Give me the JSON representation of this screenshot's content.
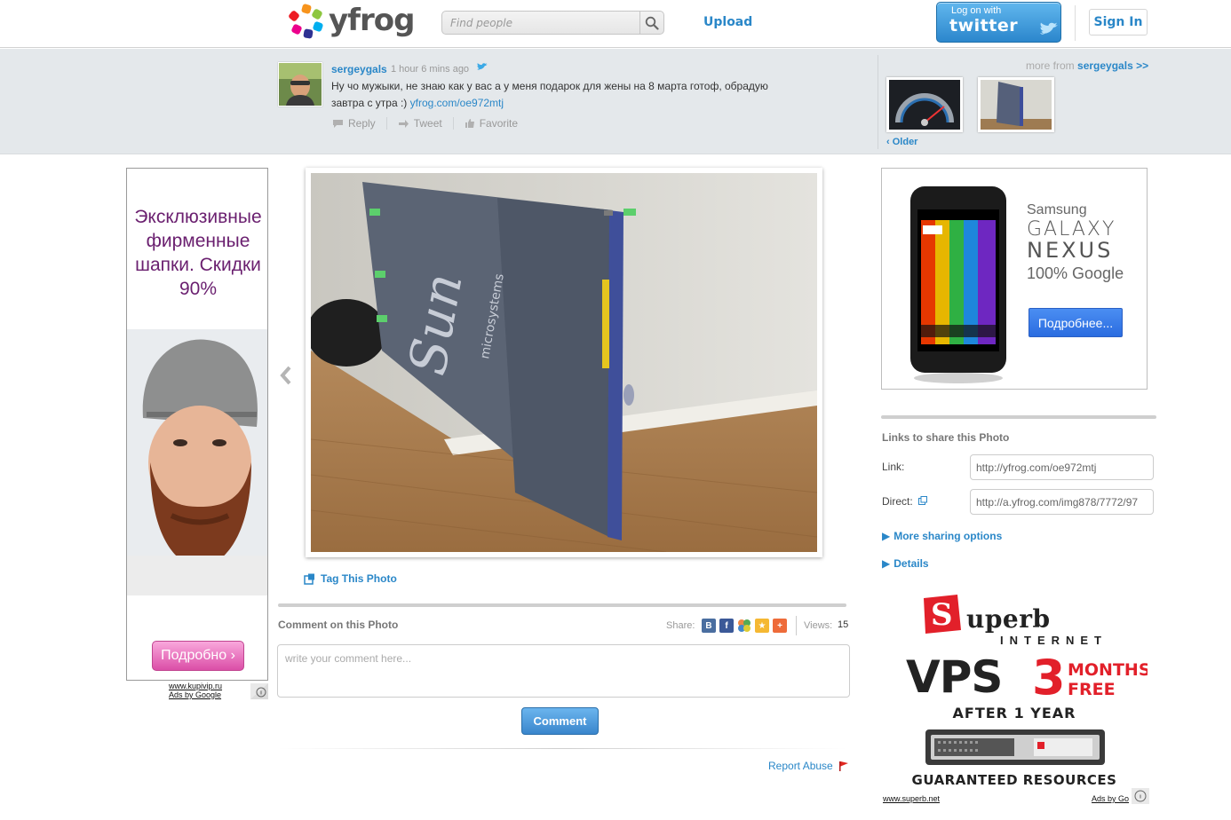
{
  "header": {
    "logo_text": "yfrog",
    "search_placeholder": "Find people",
    "upload_label": "Upload",
    "twitter_small": "Log on with",
    "twitter_big": "twitter",
    "signin_label": "Sign In"
  },
  "tweet": {
    "username": "sergeygals",
    "time": "1 hour 6 mins ago",
    "text": "Ну чо мужыки, не знаю как у вас а у меня подарок для жены на 8 марта готоф, обрадую завтра с утра :)",
    "link": "yfrog.com/oe972mtj",
    "actions": {
      "reply": "Reply",
      "tweet": "Tweet",
      "favorite": "Favorite"
    },
    "more_from_prefix": "more from",
    "more_from_user": "sergeygals >>",
    "older_label": "Older"
  },
  "ad_left": {
    "text": "Эксклюзивные фирменные шапки. Скидки 90%",
    "button": "Подробно ›",
    "url": "www.kupivip.ru",
    "ads_by": "Ads by Google"
  },
  "photo": {
    "tag_label": "Tag This Photo"
  },
  "comments": {
    "title": "Comment on this Photo",
    "share_label": "Share:",
    "views_label": "Views:",
    "views_count": "15",
    "placeholder": "write your comment here...",
    "button": "Comment",
    "report_abuse": "Report Abuse"
  },
  "ad_right": {
    "brand": "Samsung",
    "line1": "GALAXY",
    "line2": "NEXUS",
    "line3": "100% Google",
    "button": "Подробнее..."
  },
  "share": {
    "title": "Links to share this Photo",
    "link_label": "Link:",
    "link_value": "http://yfrog.com/oe972mtj",
    "direct_label": "Direct:",
    "direct_value": "http://a.yfrog.com/img878/7772/97",
    "more_sharing": "More sharing options",
    "details": "Details"
  },
  "ad_superb": {
    "brand": "uperb",
    "sub": "INTERNET",
    "vps": "VPS",
    "three": "3",
    "months": "MONTHS",
    "free": "FREE",
    "after": "AFTER 1 YEAR",
    "guaranteed": "GUARANTEED RESOURCES",
    "url": "www.superb.net",
    "ads_by": "Ads by Go"
  },
  "colors": {
    "link_blue": "#2a87c8",
    "band_gray": "#e4e8eb",
    "ad_purple": "#6a1f6f",
    "superb_red": "#e2202a"
  }
}
